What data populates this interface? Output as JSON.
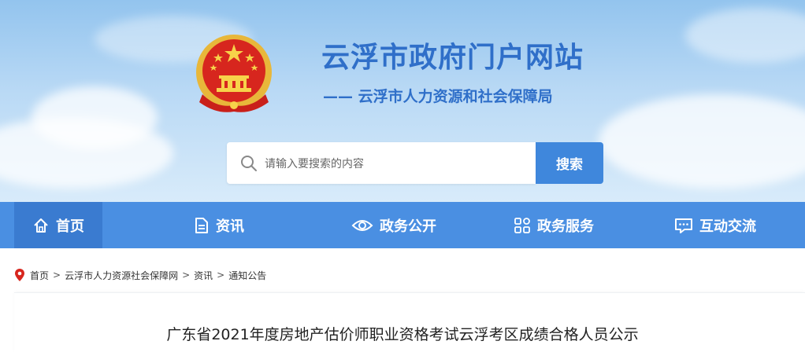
{
  "header": {
    "site_title": "云浮市政府门户网站",
    "department": "—— 云浮市人力资源和社会保障局"
  },
  "search": {
    "placeholder": "请输入要搜索的内容",
    "button_label": "搜索"
  },
  "nav": {
    "items": [
      {
        "label": "首页",
        "icon": "home-icon",
        "active": true
      },
      {
        "label": "资讯",
        "icon": "document-icon"
      },
      {
        "label": "政务公开",
        "icon": "eye-icon"
      },
      {
        "label": "政务服务",
        "icon": "grid-icon"
      },
      {
        "label": "互动交流",
        "icon": "chat-icon"
      }
    ]
  },
  "breadcrumb": {
    "items": [
      "首页",
      "云浮市人力资源社会保障网",
      "资讯",
      "通知公告"
    ],
    "separator": ">"
  },
  "article": {
    "title": "广东省2021年度房地产估价师职业资格考试云浮考区成绩合格人员公示"
  },
  "colors": {
    "brand_blue": "#2f6fc9",
    "nav_blue": "#4a8fe2",
    "nav_active": "#3a7bd0",
    "search_button": "#3f87dc",
    "emblem_red": "#d7261e",
    "emblem_gold": "#f2c14e"
  }
}
